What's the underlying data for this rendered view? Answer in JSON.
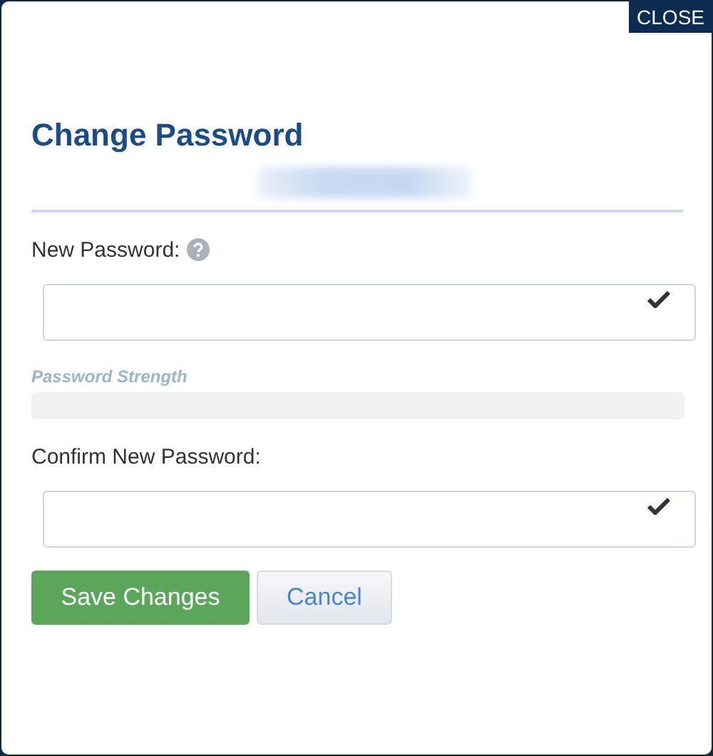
{
  "close_button": "CLOSE",
  "title": "Change Password",
  "account": {
    "redacted": true
  },
  "fields": [
    {
      "label": "New Password:",
      "help": true,
      "valid": true
    },
    {
      "label": "Confirm New Password:",
      "help": false,
      "valid": true
    }
  ],
  "strength": {
    "label": "Password Strength",
    "level": 0
  },
  "buttons": [
    {
      "label": "Save Changes",
      "kind": "primary"
    },
    {
      "label": "Cancel",
      "kind": "secondary"
    }
  ]
}
